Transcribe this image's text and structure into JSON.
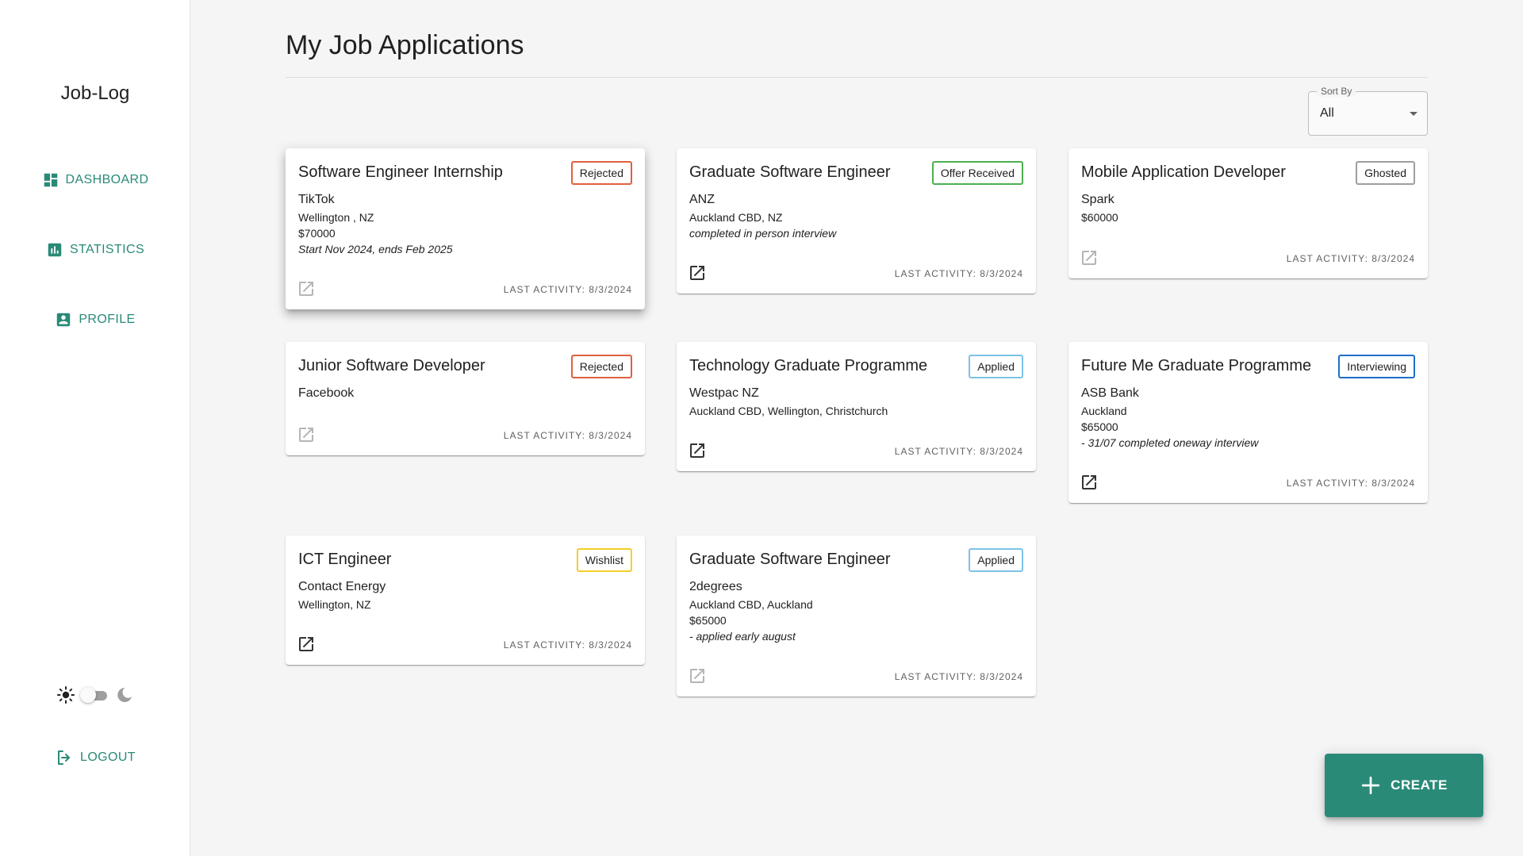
{
  "app": {
    "brand": "Job-Log"
  },
  "nav": {
    "dashboard": "DASHBOARD",
    "statistics": "STATISTICS",
    "profile": "PROFILE",
    "logout": "LOGOUT"
  },
  "theme": {
    "mode": "light"
  },
  "page": {
    "title": "My Job Applications"
  },
  "sort": {
    "label": "Sort By",
    "value": "All"
  },
  "create_label": "CREATE",
  "status_colors": {
    "Rejected": "#e0603f",
    "Offer Received": "#4caf50",
    "Ghosted": "#9e9e9e",
    "Applied": "#7cc3e6",
    "Interviewing": "#1e6fc8",
    "Wishlist": "#f2cf2a"
  },
  "accent": "#2a8a78",
  "cards": [
    {
      "role": "Software Engineer Internship",
      "status": "Rejected",
      "company": "TikTok",
      "lines": [
        {
          "text": "Wellington , NZ",
          "italic": false
        },
        {
          "text": "$70000",
          "italic": false
        },
        {
          "text": "Start Nov 2024, ends Feb 2025",
          "italic": true
        }
      ],
      "link_active": false,
      "activity": "LAST ACTIVITY: 8/3/2024"
    },
    {
      "role": "Graduate Software Engineer",
      "status": "Offer Received",
      "company": "ANZ",
      "lines": [
        {
          "text": "Auckland CBD, NZ",
          "italic": false
        },
        {
          "text": "completed in person interview",
          "italic": true
        }
      ],
      "link_active": true,
      "activity": "LAST ACTIVITY: 8/3/2024"
    },
    {
      "role": "Mobile Application Developer",
      "status": "Ghosted",
      "company": "Spark",
      "lines": [
        {
          "text": "$60000",
          "italic": false
        }
      ],
      "link_active": false,
      "activity": "LAST ACTIVITY: 8/3/2024"
    },
    {
      "role": "Junior Software Developer",
      "status": "Rejected",
      "company": "Facebook",
      "lines": [],
      "link_active": false,
      "activity": "LAST ACTIVITY: 8/3/2024"
    },
    {
      "role": "Technology Graduate Programme",
      "status": "Applied",
      "company": "Westpac NZ",
      "lines": [
        {
          "text": "Auckland CBD, Wellington, Christchurch",
          "italic": false
        }
      ],
      "link_active": true,
      "activity": "LAST ACTIVITY: 8/3/2024"
    },
    {
      "role": "Future Me Graduate Programme",
      "status": "Interviewing",
      "company": "ASB Bank",
      "lines": [
        {
          "text": "Auckland",
          "italic": false
        },
        {
          "text": "$65000",
          "italic": false
        },
        {
          "text": "- 31/07 completed oneway interview",
          "italic": true
        }
      ],
      "link_active": true,
      "activity": "LAST ACTIVITY: 8/3/2024"
    },
    {
      "role": "ICT Engineer",
      "status": "Wishlist",
      "company": "Contact Energy",
      "lines": [
        {
          "text": "Wellington, NZ",
          "italic": false
        }
      ],
      "link_active": true,
      "activity": "LAST ACTIVITY: 8/3/2024"
    },
    {
      "role": "Graduate Software Engineer",
      "status": "Applied",
      "company": "2degrees",
      "lines": [
        {
          "text": "Auckland CBD, Auckland",
          "italic": false
        },
        {
          "text": "$65000",
          "italic": false
        },
        {
          "text": "- applied early august",
          "italic": true
        }
      ],
      "link_active": false,
      "activity": "LAST ACTIVITY: 8/3/2024"
    }
  ]
}
